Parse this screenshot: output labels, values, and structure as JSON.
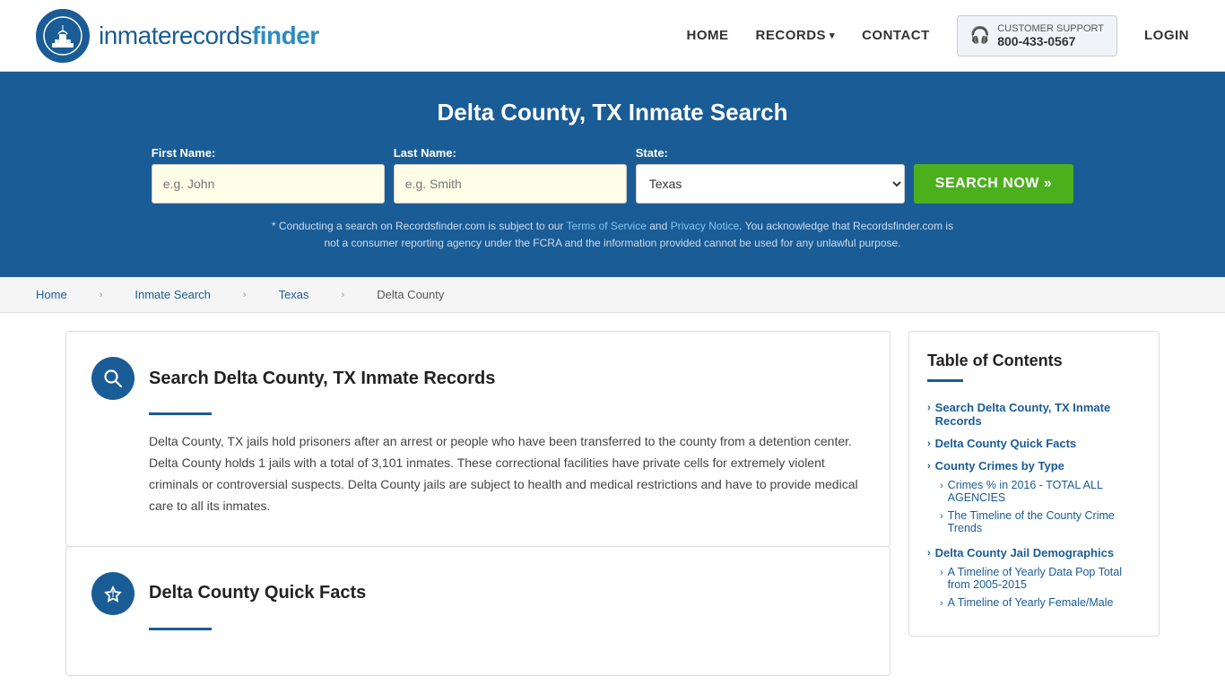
{
  "header": {
    "logo_text_main": "inmaterecords",
    "logo_text_bold": "finder",
    "nav": {
      "home": "HOME",
      "records": "RECORDS",
      "contact": "CONTACT",
      "support_label": "CUSTOMER SUPPORT",
      "support_number": "800-433-0567",
      "login": "LOGIN"
    }
  },
  "hero": {
    "title": "Delta County, TX Inmate Search",
    "first_name_label": "First Name:",
    "first_name_placeholder": "e.g. John",
    "last_name_label": "Last Name:",
    "last_name_placeholder": "e.g. Smith",
    "state_label": "State:",
    "state_value": "Texas",
    "search_button": "SEARCH NOW »",
    "disclaimer": "* Conducting a search on Recordsfinder.com is subject to our Terms of Service and Privacy Notice. You acknowledge that Recordsfinder.com is not a consumer reporting agency under the FCRA and the information provided cannot be used for any unlawful purpose."
  },
  "breadcrumb": {
    "home": "Home",
    "inmate_search": "Inmate Search",
    "texas": "Texas",
    "current": "Delta County"
  },
  "main_section": {
    "search_section": {
      "title": "Search Delta County, TX Inmate Records",
      "body": "Delta County, TX jails hold prisoners after an arrest or people who have been transferred to the county from a detention center. Delta County holds 1 jails with a total of 3,101 inmates. These correctional facilities have private cells for extremely violent criminals or controversial suspects. Delta County jails are subject to health and medical restrictions and have to provide medical care to all its inmates."
    },
    "quick_facts_section": {
      "title": "Delta County Quick Facts"
    }
  },
  "toc": {
    "title": "Table of Contents",
    "items": [
      {
        "label": "Search Delta County, TX Inmate Records",
        "sub_items": []
      },
      {
        "label": "Delta County Quick Facts",
        "sub_items": []
      },
      {
        "label": "County Crimes by Type",
        "sub_items": [
          "Crimes % in 2016 - TOTAL ALL AGENCIES",
          "The Timeline of the County Crime Trends"
        ]
      },
      {
        "label": "Delta County Jail Demographics",
        "sub_items": [
          "A Timeline of Yearly Data Pop Total from 2005-2015",
          "A Timeline of Yearly Female/Male"
        ]
      }
    ]
  }
}
